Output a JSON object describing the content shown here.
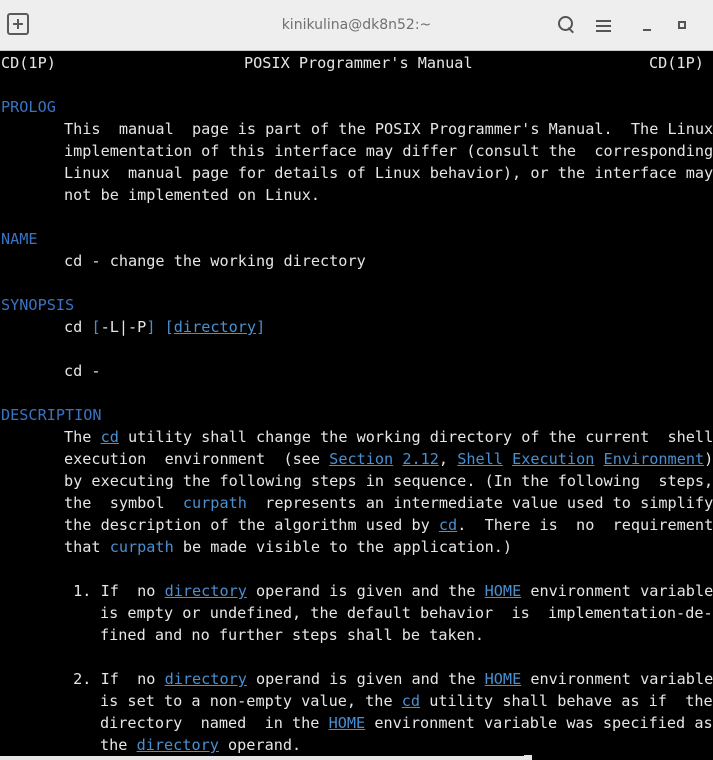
{
  "window": {
    "title": "kinikulina@dk8n52:~"
  },
  "icons": [
    "new-tab-icon",
    "search-icon",
    "hamburger-menu-icon",
    "minimize-icon",
    "maximize-icon"
  ],
  "colors": {
    "background": "#000000",
    "text": "#e6e6e6",
    "heading": "#3b73c4",
    "link": "#4a8fd0",
    "titlebar": "#eeeeee"
  },
  "man": {
    "header": {
      "left": "CD(1P)",
      "center": "POSIX Programmer's Manual",
      "right": "CD(1P)"
    },
    "prolog": {
      "heading": "PROLOG",
      "lines": [
        "This  manual  page is part of the POSIX Programmer's Manual.  The Linux",
        "implementation of this interface may differ (consult the  corresponding",
        "Linux  manual page for details of Linux behavior), or the interface may",
        "not be implemented on Linux."
      ]
    },
    "name": {
      "heading": "NAME",
      "line": "cd - change the working directory"
    },
    "synopsis": {
      "heading": "SYNOPSIS",
      "l1_cmd": "cd ",
      "l1_b1": "[",
      "l1_opt": "-L|-P",
      "l1_b2": "]",
      "l1_sp": " ",
      "l1_b3": "[",
      "l1_arg": "directory",
      "l1_b4": "]",
      "l2": "cd -"
    },
    "description": {
      "heading": "DESCRIPTION",
      "l1_a": "The ",
      "l1_link": "cd",
      "l1_b": " utility shall change the working directory of the current  shell",
      "l2_a": "execution  environment  (see ",
      "l2_l1": "Section",
      "l2_s1": " ",
      "l2_l2": "2.12",
      "l2_s2": ", ",
      "l2_l3": "Shell",
      "l2_s3": " ",
      "l2_l4": "Execution",
      "l2_s4": " ",
      "l2_l5": "Environment",
      "l2_b": ")",
      "l3": "by executing the following steps in sequence. (In the following  steps,",
      "l4_a": "the  symbol  ",
      "l4_var": "curpath",
      "l4_b": "  represents an intermediate value used to simplify",
      "l5_a": "the description of the algorithm used by ",
      "l5_link": "cd",
      "l5_b": ".  There is  no  requirement",
      "l6_a": "that ",
      "l6_var": "curpath",
      "l6_b": " be made visible to the application.)"
    },
    "steps": [
      {
        "l1_a": " 1. If  no ",
        "l1_link1": "directory",
        "l1_b": " operand is given and the ",
        "l1_link2": "HOME",
        "l1_c": " environment variable",
        "l2": "is empty or undefined, the default behavior  is  implementation-de‐",
        "l3": "fined and no further steps shall be taken."
      },
      {
        "l1_a": " 2. If  no ",
        "l1_link1": "directory",
        "l1_b": " operand is given and the ",
        "l1_link2": "HOME",
        "l1_c": " environment variable",
        "l2_a": "is set to a non-empty value, the ",
        "l2_link": "cd",
        "l2_b": " utility shall behave as if  the",
        "l3_a": "directory  named  in the ",
        "l3_link": "HOME",
        "l3_b": " environment variable was specified as",
        "l4_a": "the ",
        "l4_link": "directory",
        "l4_b": " operand."
      }
    ]
  }
}
